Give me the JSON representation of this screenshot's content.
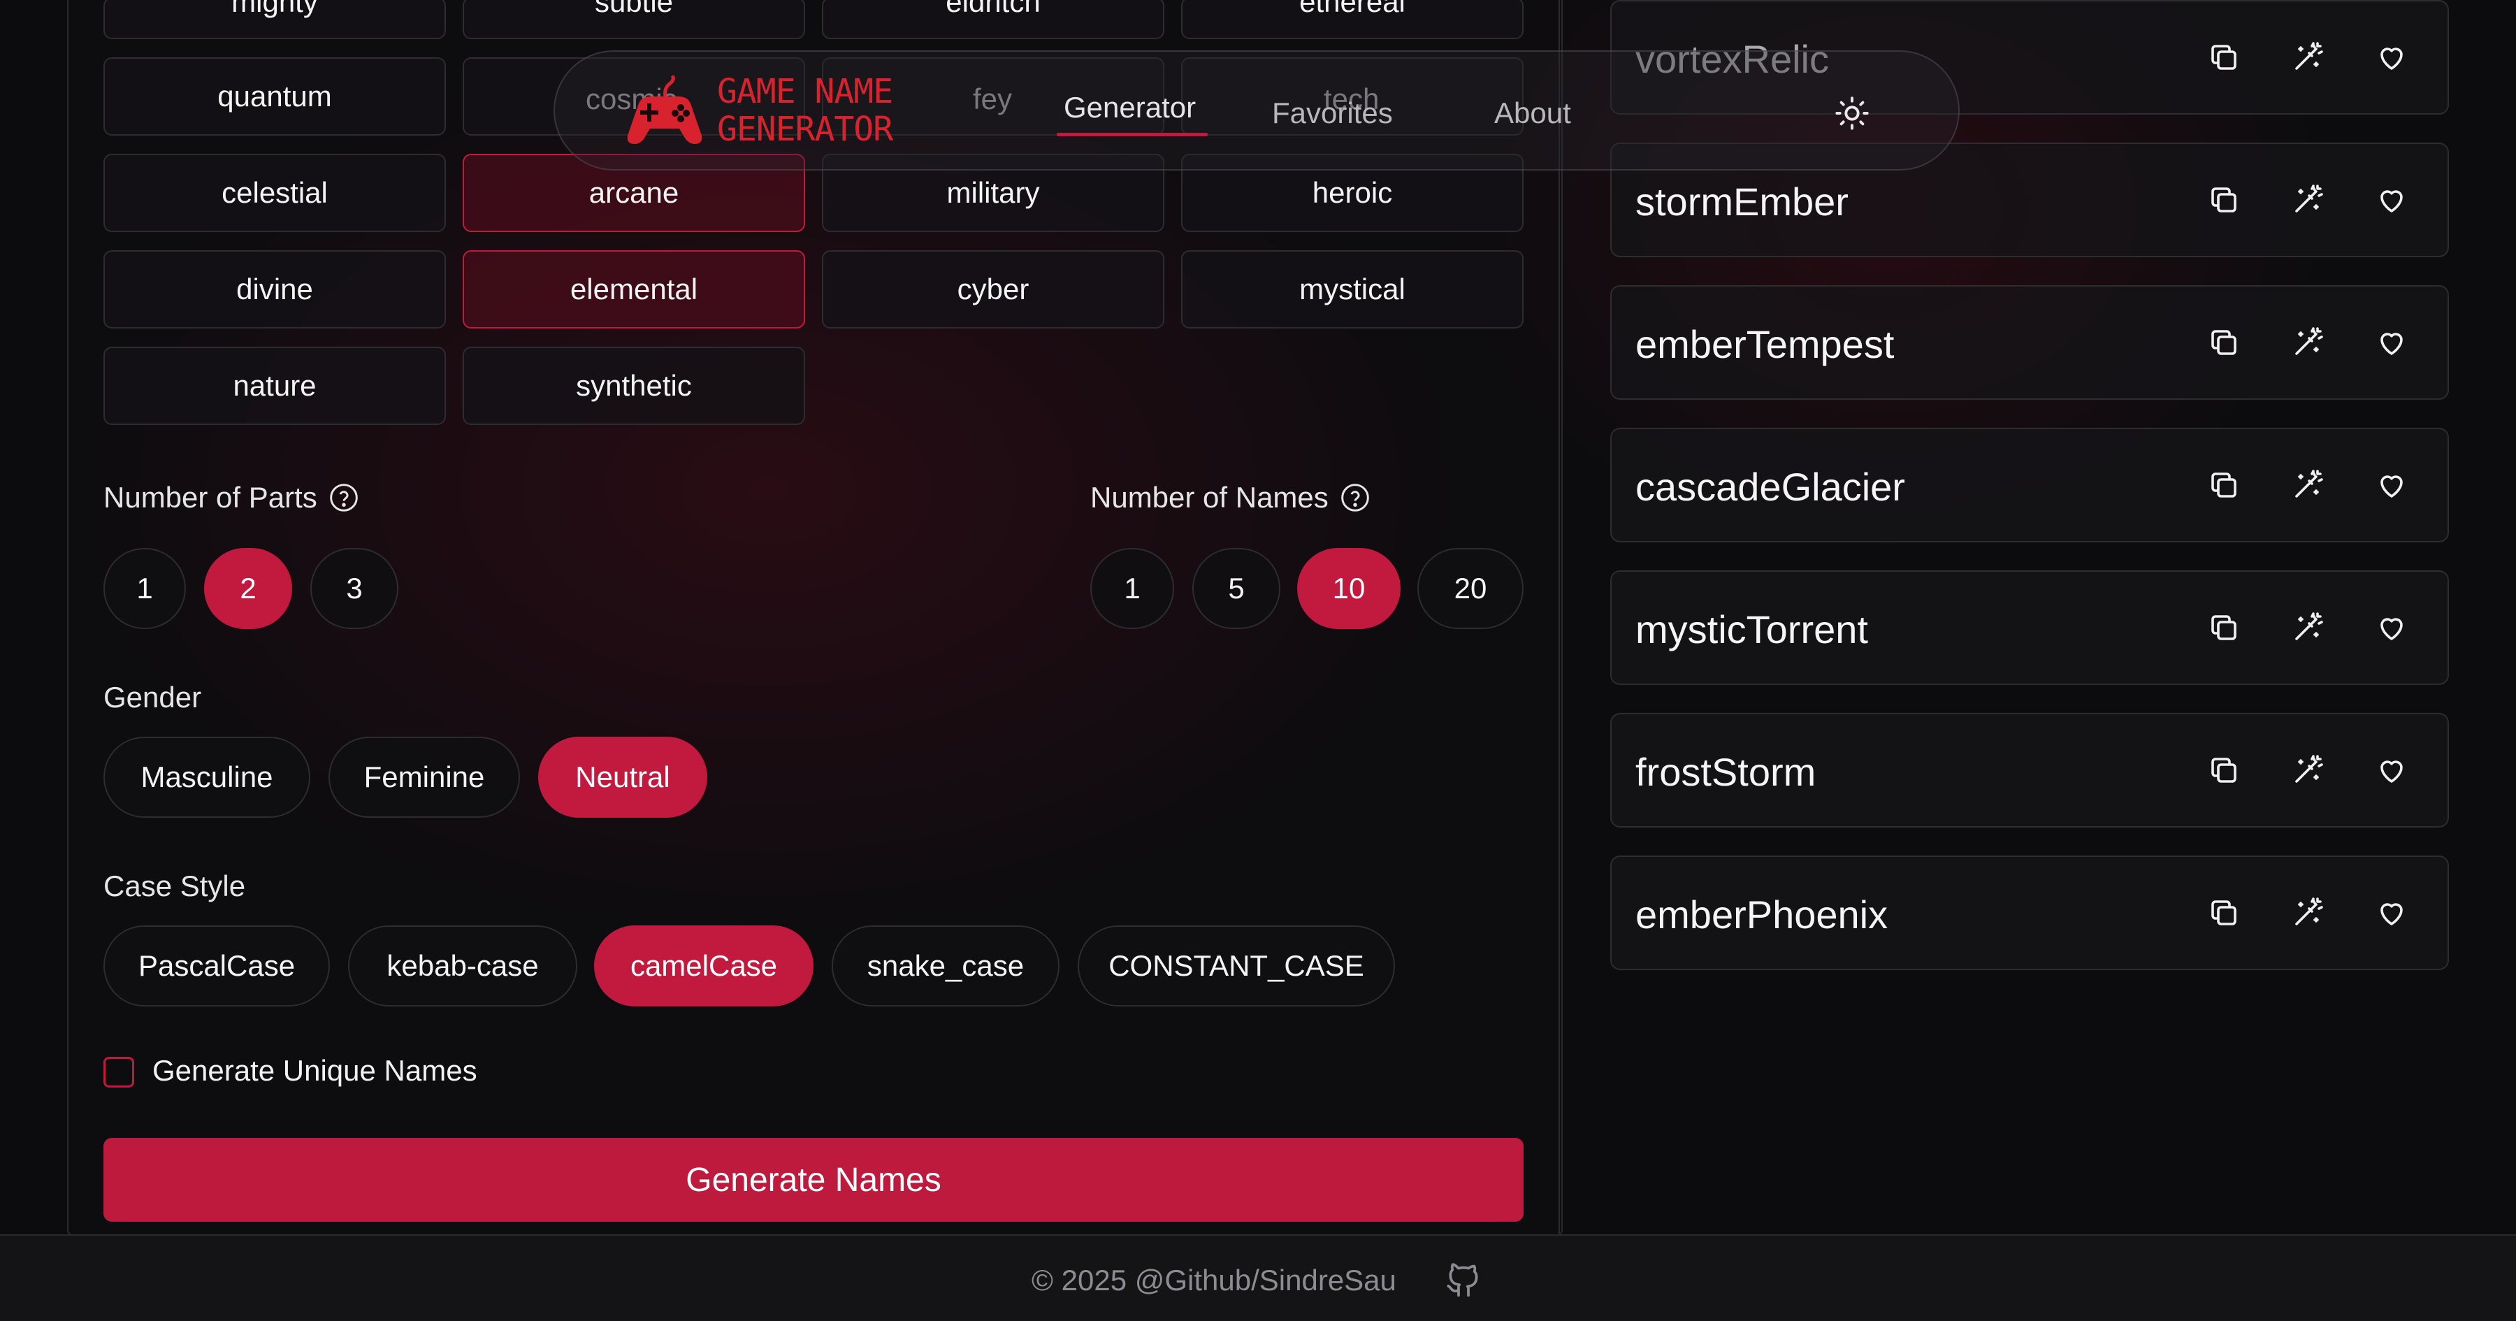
{
  "nav": {
    "logo_line1": "GAME NAME",
    "logo_line2": "GENERATOR",
    "links": [
      "Generator",
      "Favorites",
      "About"
    ],
    "active": "Generator"
  },
  "chips": {
    "row_partial": [
      "mighty",
      "subtle",
      "eldritch",
      "ethereal"
    ],
    "row1": [
      "quantum",
      "cosmic",
      "fey",
      "tech"
    ],
    "row2": [
      "celestial",
      "arcane",
      "military",
      "heroic"
    ],
    "row3": [
      "divine",
      "elemental",
      "cyber",
      "mystical"
    ],
    "row4": [
      "nature",
      "synthetic"
    ],
    "selected": [
      "arcane",
      "elemental"
    ]
  },
  "parts": {
    "label": "Number of Parts",
    "options": [
      "1",
      "2",
      "3"
    ],
    "selected": "2"
  },
  "names_count": {
    "label": "Number of Names",
    "options": [
      "1",
      "5",
      "10",
      "20"
    ],
    "selected": "10"
  },
  "gender": {
    "label": "Gender",
    "options": [
      "Masculine",
      "Feminine",
      "Neutral"
    ],
    "selected": "Neutral"
  },
  "case_style": {
    "label": "Case Style",
    "options": [
      "PascalCase",
      "kebab-case",
      "camelCase",
      "snake_case",
      "CONSTANT_CASE"
    ],
    "selected": "camelCase"
  },
  "unique": {
    "label": "Generate Unique Names",
    "checked": false
  },
  "generate_button": "Generate Names",
  "results": [
    "vortexRelic",
    "stormEmber",
    "emberTempest",
    "cascadeGlacier",
    "mysticTorrent",
    "frostStorm",
    "emberPhoenix"
  ],
  "result_actions": [
    "copy-icon",
    "magic-wand-icon",
    "heart-icon"
  ],
  "footer": {
    "text": "© 2025 @Github/SindreSau"
  },
  "colors": {
    "accent": "#c2193f",
    "background": "#0c0c0f",
    "logo": "#d8232f"
  }
}
